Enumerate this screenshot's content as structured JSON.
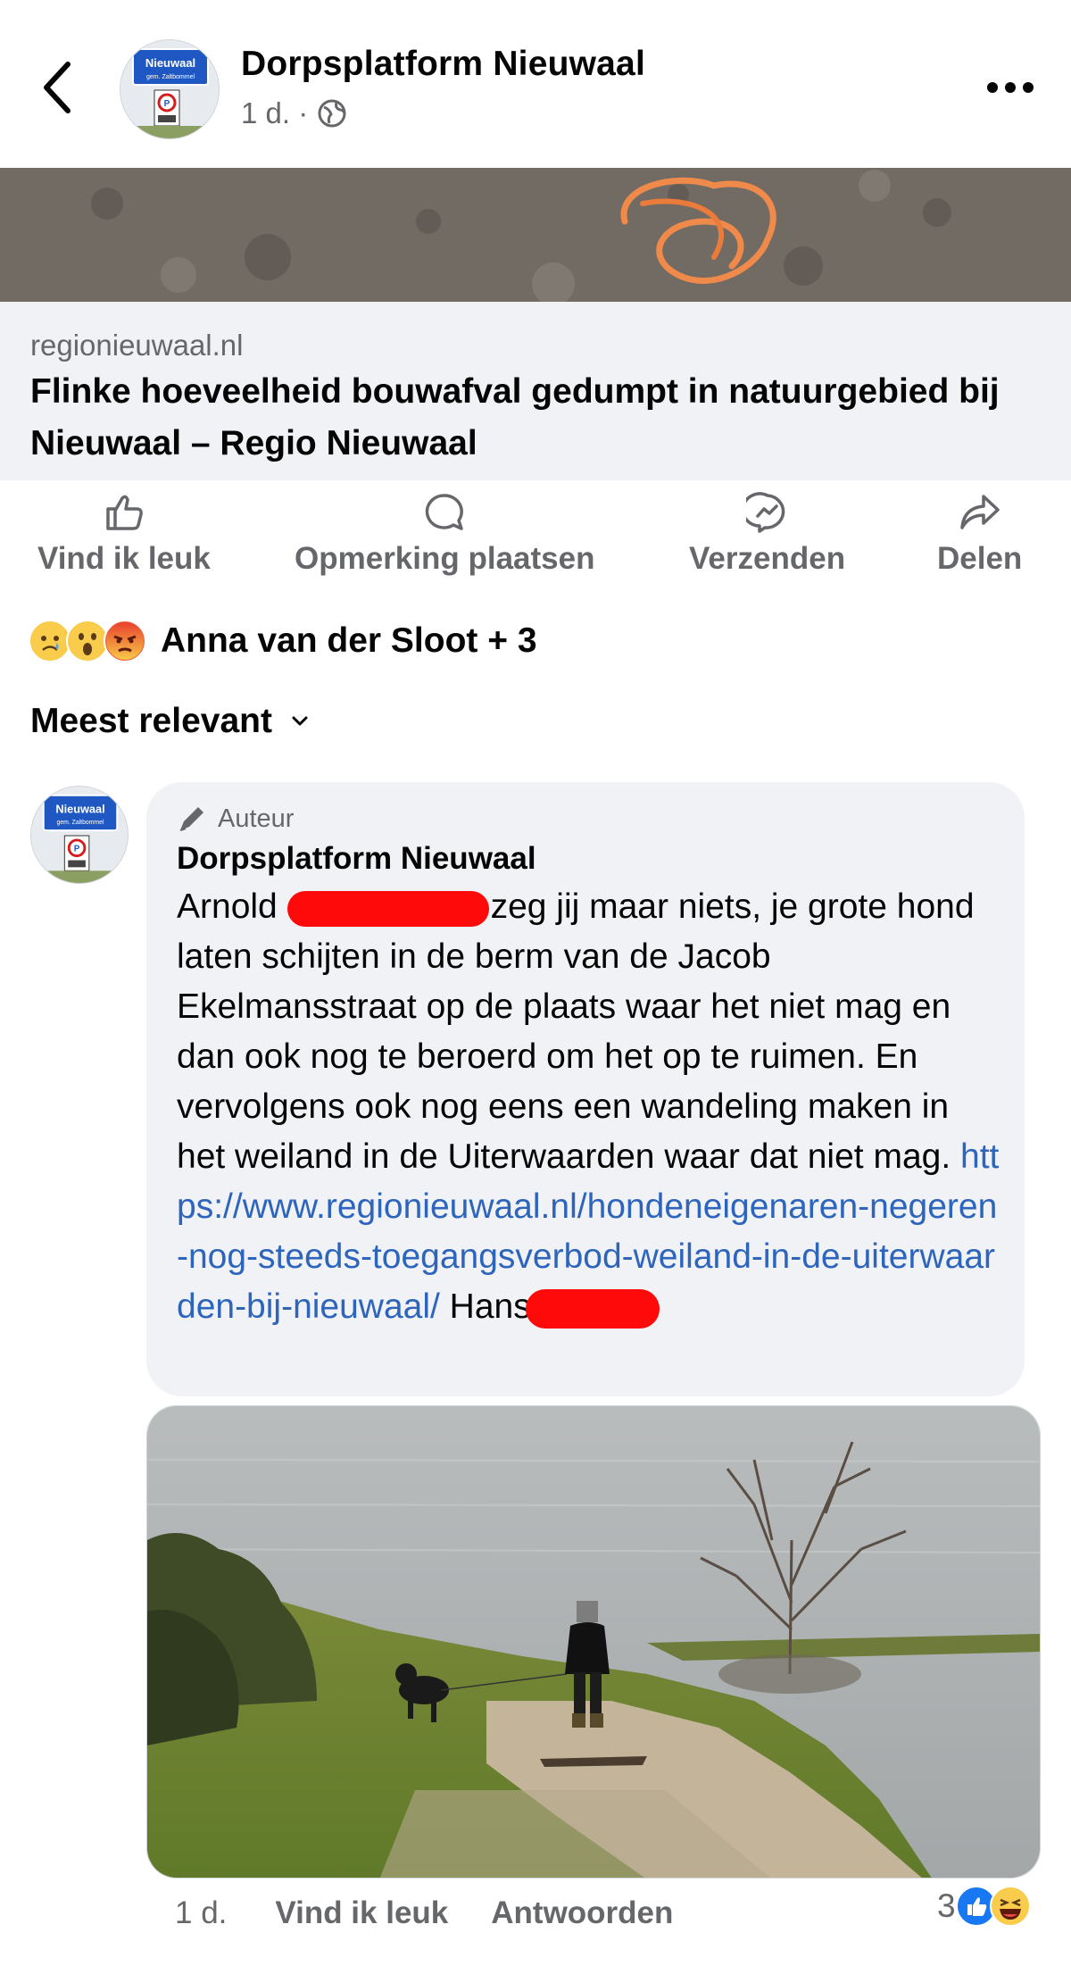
{
  "header": {
    "title": "Dorpsplatform Nieuwaal",
    "time": "1 d. ·",
    "avatar_sign_text": "Nieuwaal",
    "avatar_sign_sub": "gem. Zaltbommel"
  },
  "link_preview": {
    "domain": "regionieuwaal.nl",
    "title": "Flinke hoeveelheid bouwafval gedumpt in natuurgebied bij Nieuwaal – Regio Nieuwaal"
  },
  "actions": {
    "like": "Vind ik leuk",
    "comment": "Opmerking plaatsen",
    "send": "Verzenden",
    "share": "Delen"
  },
  "reactions": {
    "text": "Anna van der Sloot + 3",
    "icons": [
      "sad-emoji",
      "wow-emoji",
      "angry-emoji"
    ]
  },
  "sort": {
    "label": "Meest relevant"
  },
  "comment": {
    "badge": "Auteur",
    "author": "Dorpsplatform Nieuwaal",
    "text_part1": "Arnold ",
    "text_part2": "zeg jij maar niets, je grote hond laten schijten in de berm van de Jacob Ekelmansstraat op de plaats waar het niet mag en dan ook nog te beroerd om het op te ruimen. En vervolgens ook nog eens een wandeling maken in het weiland in de Uiterwaarden waar dat niet mag. ",
    "link": "https://www.regionieuwaal.nl/hondeneigenaren-negeren-nog-steeds-toegangsverbod-weiland-in-de-uiterwaarden-bij-nieuwaal/",
    "text_part3": " Hans",
    "time": "1 d.",
    "like": "Vind ik leuk",
    "reply": "Antwoorden",
    "reaction_count": "3",
    "reaction_icons": [
      "like-emoji",
      "haha-emoji"
    ]
  },
  "colors": {
    "accent_link": "#2d64bc",
    "muted": "#65676b",
    "bubble_bg": "#f0f2f5",
    "redaction": "#ff0a0a"
  }
}
